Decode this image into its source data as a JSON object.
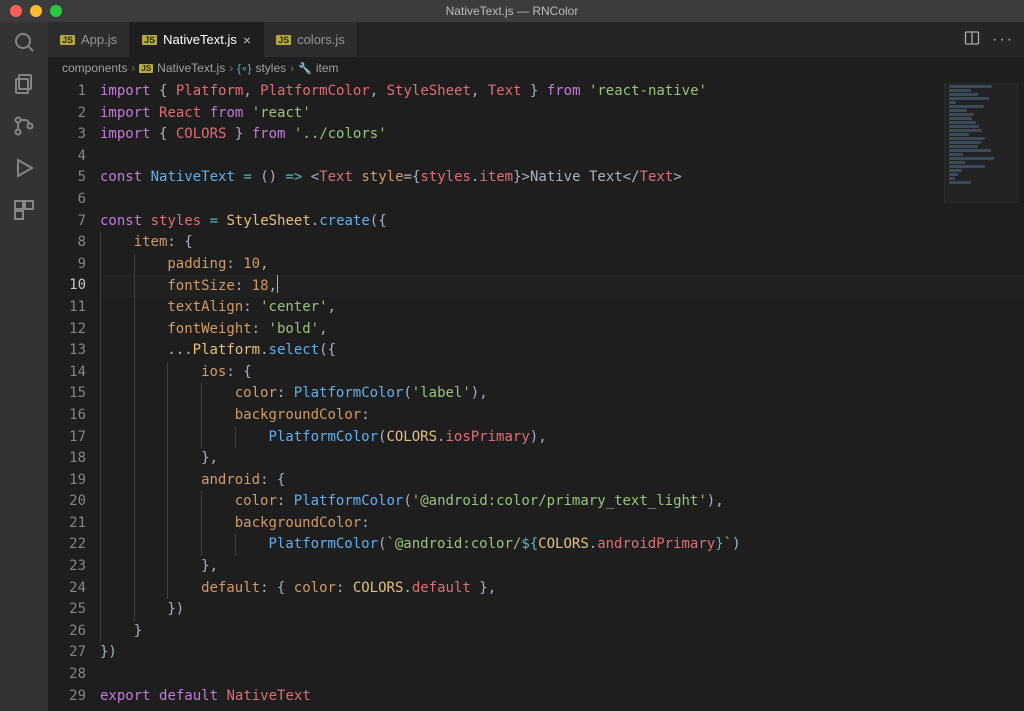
{
  "window": {
    "title": "NativeText.js — RNColor"
  },
  "tabs": [
    {
      "label": "App.js",
      "active": false
    },
    {
      "label": "NativeText.js",
      "active": true
    },
    {
      "label": "colors.js",
      "active": false
    }
  ],
  "breadcrumbs": {
    "seg0": "components",
    "seg1": "NativeText.js",
    "seg2": "styles",
    "seg3": "item"
  },
  "lineNumbers": [
    "1",
    "2",
    "3",
    "4",
    "5",
    "6",
    "7",
    "8",
    "9",
    "10",
    "11",
    "12",
    "13",
    "14",
    "15",
    "16",
    "17",
    "18",
    "19",
    "20",
    "21",
    "22",
    "23",
    "24",
    "25",
    "26",
    "27",
    "28",
    "29"
  ],
  "code": {
    "l1": {
      "a": "import",
      "b": " { ",
      "c": "Platform",
      "d": ", ",
      "e": "PlatformColor",
      "f": ", ",
      "g": "StyleSheet",
      "h": ", ",
      "i": "Text",
      "j": " } ",
      "k": "from",
      "l": " ",
      "m": "'react-native'"
    },
    "l2": {
      "a": "import",
      "b": " ",
      "c": "React",
      "d": " ",
      "e": "from",
      "f": " ",
      "g": "'react'"
    },
    "l3": {
      "a": "import",
      "b": " { ",
      "c": "COLORS",
      "d": " } ",
      "e": "from",
      "f": " ",
      "g": "'../colors'"
    },
    "l5": {
      "a": "const",
      "b": " ",
      "c": "NativeText",
      "d": " ",
      "e": "=",
      "f": " () ",
      "g": "=>",
      "h": " <",
      "i": "Text",
      "j": " ",
      "k": "style",
      "l": "={",
      "m": "styles",
      "n": ".",
      "o": "item",
      "p": "}>",
      "q": "Native Text",
      "r": "</",
      "s": "Text",
      "t": ">"
    },
    "l7": {
      "a": "const",
      "b": " ",
      "c": "styles",
      "d": " ",
      "e": "=",
      "f": " ",
      "g": "StyleSheet",
      "h": ".",
      "i": "create",
      "j": "({"
    },
    "l8": {
      "a": "item",
      "b": ": {"
    },
    "l9": {
      "a": "padding",
      "b": ": ",
      "c": "10",
      "d": ","
    },
    "l10": {
      "a": "fontSize",
      "b": ": ",
      "c": "18",
      "d": ","
    },
    "l11": {
      "a": "textAlign",
      "b": ": ",
      "c": "'center'",
      "d": ","
    },
    "l12": {
      "a": "fontWeight",
      "b": ": ",
      "c": "'bold'",
      "d": ","
    },
    "l13": {
      "a": "...",
      "b": "Platform",
      "c": ".",
      "d": "select",
      "e": "({"
    },
    "l14": {
      "a": "ios",
      "b": ": {"
    },
    "l15": {
      "a": "color",
      "b": ": ",
      "c": "PlatformColor",
      "d": "(",
      "e": "'label'",
      "f": "),"
    },
    "l16": {
      "a": "backgroundColor",
      "b": ":"
    },
    "l17": {
      "a": "PlatformColor",
      "b": "(",
      "c": "COLORS",
      "d": ".",
      "e": "iosPrimary",
      "f": "),"
    },
    "l18": {
      "a": "},"
    },
    "l19": {
      "a": "android",
      "b": ": {"
    },
    "l20": {
      "a": "color",
      "b": ": ",
      "c": "PlatformColor",
      "d": "(",
      "e": "'@android:color/primary_text_light'",
      "f": "),"
    },
    "l21": {
      "a": "backgroundColor",
      "b": ":"
    },
    "l22": {
      "a": "PlatformColor",
      "b": "(",
      "c": "`@android:color/",
      "d": "${",
      "e": "COLORS",
      "f": ".",
      "g": "androidPrimary",
      "h": "}",
      "i": "`",
      "j": ")"
    },
    "l23": {
      "a": "},"
    },
    "l24": {
      "a": "default",
      "b": ": { ",
      "c": "color",
      "d": ": ",
      "e": "COLORS",
      "f": ".",
      "g": "default",
      "h": " },"
    },
    "l25": {
      "a": "})"
    },
    "l26": {
      "a": "}"
    },
    "l27": {
      "a": "})"
    },
    "l29": {
      "a": "export",
      "b": " ",
      "c": "default",
      "d": " ",
      "e": "NativeText"
    }
  }
}
